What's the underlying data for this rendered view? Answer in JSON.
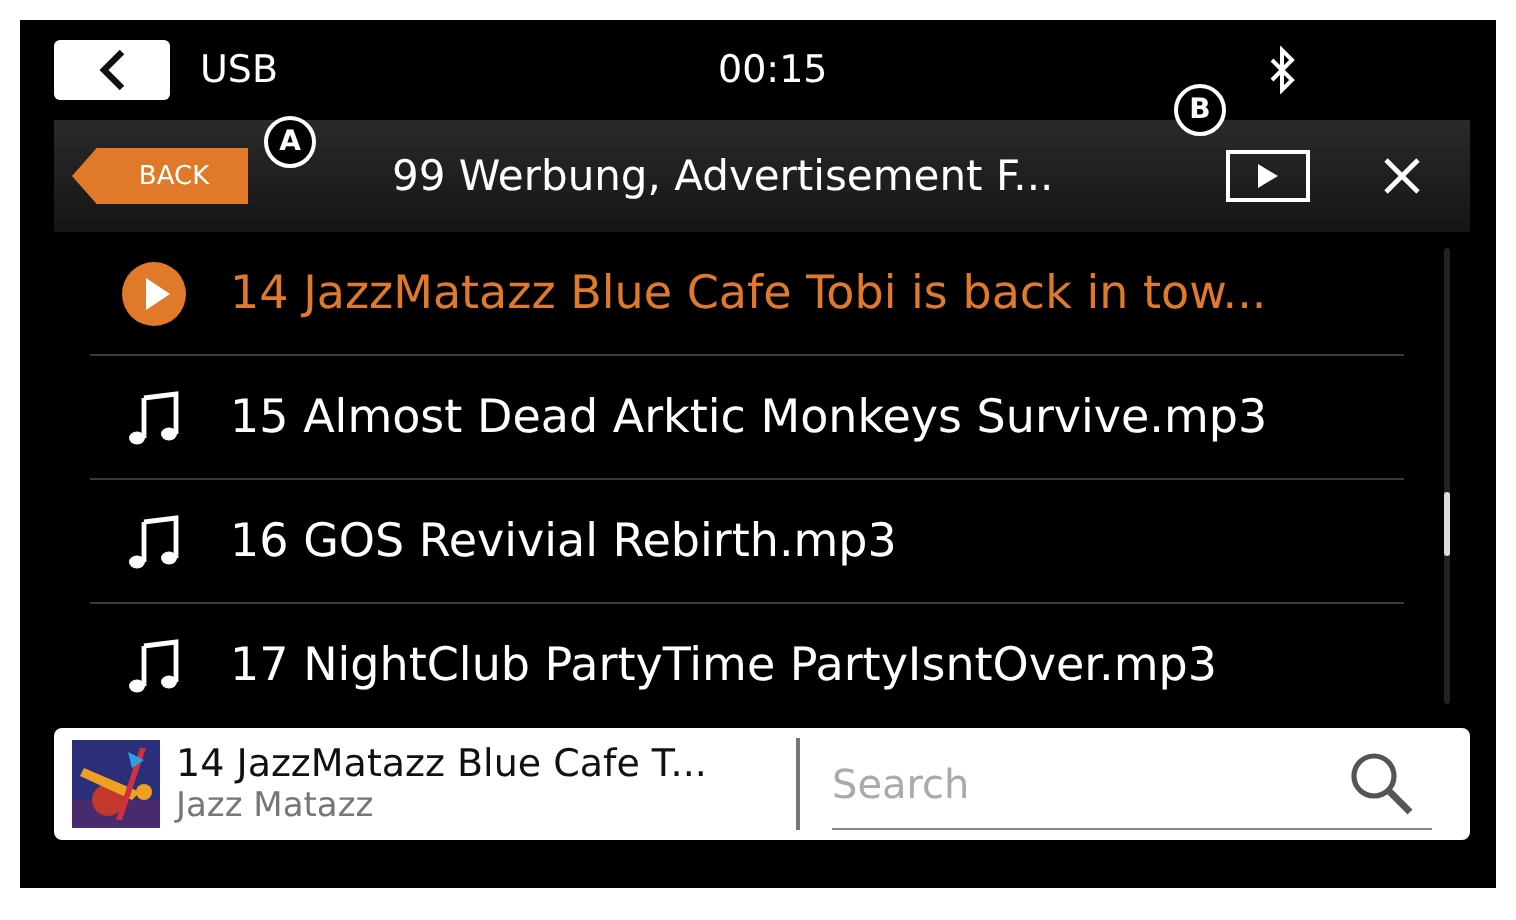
{
  "top_bar": {
    "source": "USB",
    "time": "00:15"
  },
  "header": {
    "back_button": "BACK",
    "title": "99 Werbung, Advertisement F...",
    "callouts": [
      "A",
      "B"
    ]
  },
  "tracks": [
    {
      "title": "14 JazzMatazz Blue Cafe Tobi is back in tow...",
      "selected": true
    },
    {
      "title": "15 Almost Dead Arktic Monkeys Survive.mp3",
      "selected": false
    },
    {
      "title": "16 GOS Revivial Rebirth.mp3",
      "selected": false
    },
    {
      "title": "17 NightClub PartyTime PartyIsntOver.mp3",
      "selected": false
    }
  ],
  "now_playing": {
    "title": "14 JazzMatazz Blue Cafe T...",
    "artist": "Jazz Matazz"
  },
  "search": {
    "placeholder": "Search"
  }
}
